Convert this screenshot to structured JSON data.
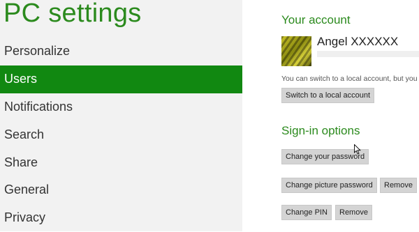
{
  "app": {
    "title": "PC settings"
  },
  "sidebar": {
    "items": [
      {
        "label": "Personalize"
      },
      {
        "label": "Users",
        "selected": true
      },
      {
        "label": "Notifications"
      },
      {
        "label": "Search"
      },
      {
        "label": "Share"
      },
      {
        "label": "General"
      },
      {
        "label": "Privacy"
      }
    ]
  },
  "account": {
    "heading": "Your account",
    "user_name": "Angel XXXXXX",
    "hint": "You can switch to a local account, but you",
    "switch_button": "Switch to a local account"
  },
  "signin": {
    "heading": "Sign-in options",
    "change_password": "Change your password",
    "change_picture_password": "Change picture password",
    "remove_picture_password": "Remove",
    "change_pin": "Change PIN",
    "remove_pin": "Remove"
  },
  "colors": {
    "accent": "#2b8a1d",
    "selected_bg": "#118811",
    "sidebar_bg": "#f2f2f2",
    "button_bg": "#d4d4d4"
  },
  "icons": {
    "avatar": "user-avatar-image",
    "pointer": "mouse-pointer-icon"
  }
}
